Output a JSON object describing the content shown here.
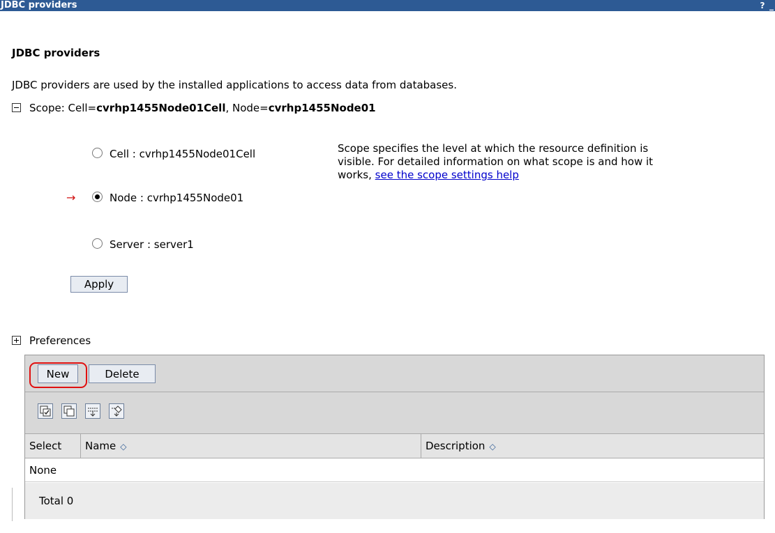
{
  "titlebar": {
    "title": "JDBC providers",
    "help_label": "?",
    "minimize_label": "_"
  },
  "page": {
    "heading": "JDBC providers",
    "description": "JDBC providers are used by the installed applications to access data from databases."
  },
  "scope": {
    "prefix": "Scope: Cell=",
    "cell_value": "cvrhp1455Node01Cell",
    "node_sep": ", Node=",
    "node_value": "cvrhp1455Node01",
    "options": [
      {
        "label": "Cell : cvrhp1455Node01Cell",
        "selected": false
      },
      {
        "label": "Node : cvrhp1455Node01",
        "selected": true
      },
      {
        "label": "Server : server1",
        "selected": false
      }
    ],
    "help_text": "Scope specifies the level at which the resource definition is visible. For detailed information on what scope is and how it works,",
    "help_link": "see the scope settings help",
    "arrow": "→",
    "apply_label": "Apply"
  },
  "preferences": {
    "label": "Preferences"
  },
  "toolbar": {
    "new_label": "New",
    "delete_label": "Delete"
  },
  "table": {
    "columns": [
      "Select",
      "Name",
      "Description"
    ],
    "sort_glyph": "◇",
    "empty_text": "None",
    "total_text": "Total 0"
  },
  "colors": {
    "title_bar": "#2d5a94",
    "link": "#0000cc",
    "highlight": "#e01010"
  }
}
